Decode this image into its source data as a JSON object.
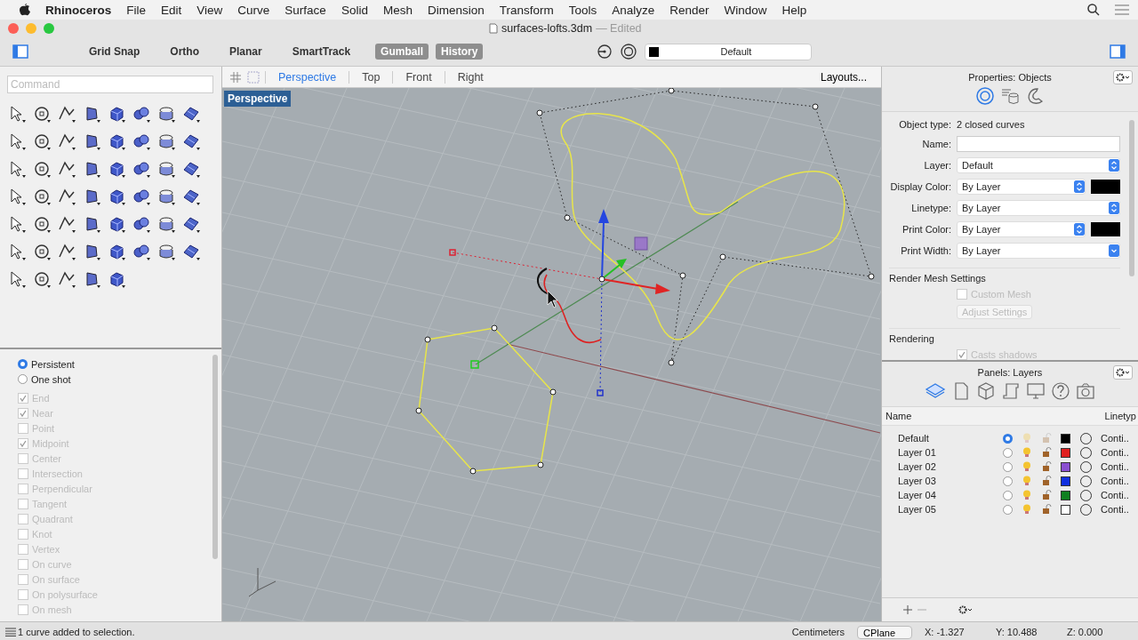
{
  "menu_bar": {
    "app": "Rhinoceros",
    "items": [
      "File",
      "Edit",
      "View",
      "Curve",
      "Surface",
      "Solid",
      "Mesh",
      "Dimension",
      "Transform",
      "Tools",
      "Analyze",
      "Render",
      "Window",
      "Help"
    ]
  },
  "window": {
    "title": "surfaces-lofts.3dm",
    "edited": "— Edited"
  },
  "toolbar": {
    "toggles": [
      {
        "label": "Grid Snap",
        "on": false
      },
      {
        "label": "Ortho",
        "on": false
      },
      {
        "label": "Planar",
        "on": false
      },
      {
        "label": "SmartTrack",
        "on": false
      },
      {
        "label": "Gumball",
        "on": true
      },
      {
        "label": "History",
        "on": true
      }
    ],
    "layer": {
      "value": "Default",
      "color": "#000000"
    }
  },
  "command": {
    "placeholder": "Command"
  },
  "osnap": {
    "disabled": true,
    "modes": [
      {
        "label": "Persistent",
        "selected": true
      },
      {
        "label": "One shot",
        "selected": false
      }
    ],
    "items": [
      {
        "label": "End",
        "checked": true
      },
      {
        "label": "Near",
        "checked": true
      },
      {
        "label": "Point",
        "checked": false
      },
      {
        "label": "Midpoint",
        "checked": true
      },
      {
        "label": "Center",
        "checked": false
      },
      {
        "label": "Intersection",
        "checked": false
      },
      {
        "label": "Perpendicular",
        "checked": false
      },
      {
        "label": "Tangent",
        "checked": false
      },
      {
        "label": "Quadrant",
        "checked": false
      },
      {
        "label": "Knot",
        "checked": false
      },
      {
        "label": "Vertex",
        "checked": false
      },
      {
        "label": "On curve",
        "checked": false
      },
      {
        "label": "On surface",
        "checked": false
      },
      {
        "label": "On polysurface",
        "checked": false
      },
      {
        "label": "On mesh",
        "checked": false
      }
    ]
  },
  "viewport": {
    "tabs": [
      {
        "label": "Perspective",
        "selected": true
      },
      {
        "label": "Top",
        "selected": false
      },
      {
        "label": "Front",
        "selected": false
      },
      {
        "label": "Right",
        "selected": false
      }
    ],
    "layouts": "Layouts...",
    "label": "Perspective"
  },
  "properties": {
    "title": "Properties: Objects",
    "object_type_label": "Object type:",
    "object_type": "2 closed curves",
    "fields": [
      {
        "kind": "text",
        "label": "Name:"
      },
      {
        "kind": "select",
        "label": "Layer:",
        "value": "Default"
      },
      {
        "kind": "color",
        "label": "Display Color:",
        "value": "By Layer",
        "color": "#000000"
      },
      {
        "kind": "select",
        "label": "Linetype:",
        "value": "By Layer"
      },
      {
        "kind": "color",
        "label": "Print Color:",
        "value": "By Layer",
        "color": "#000000"
      },
      {
        "kind": "dropdown",
        "label": "Print Width:",
        "value": "By Layer"
      }
    ],
    "render_mesh": {
      "heading": "Render Mesh Settings",
      "custom_mesh": {
        "label": "Custom Mesh",
        "checked": false,
        "disabled": true
      },
      "adjust": {
        "label": "Adjust Settings",
        "disabled": true
      }
    },
    "rendering": {
      "heading": "Rendering",
      "casts_shadows": {
        "label": "Casts shadows",
        "checked": true,
        "disabled": true
      }
    }
  },
  "layers": {
    "title": "Panels: Layers",
    "columns": [
      "Name",
      "Linetyp"
    ],
    "rows": [
      {
        "name": "Default",
        "current": true,
        "color": "#000000",
        "linetype": "Conti.."
      },
      {
        "name": "Layer 01",
        "current": false,
        "color": "#e02020",
        "linetype": "Conti.."
      },
      {
        "name": "Layer 02",
        "current": false,
        "color": "#8a4fd0",
        "linetype": "Conti.."
      },
      {
        "name": "Layer 03",
        "current": false,
        "color": "#1030e0",
        "linetype": "Conti.."
      },
      {
        "name": "Layer 04",
        "current": false,
        "color": "#108020",
        "linetype": "Conti.."
      },
      {
        "name": "Layer 05",
        "current": false,
        "color": "#ffffff",
        "linetype": "Conti.."
      }
    ]
  },
  "status_bar": {
    "message": "1 curve added to selection.",
    "units": "Centimeters",
    "plane": "CPlane",
    "x": "X: -1.327",
    "y": "Y: 10.488",
    "z": "Z: 0.000"
  }
}
